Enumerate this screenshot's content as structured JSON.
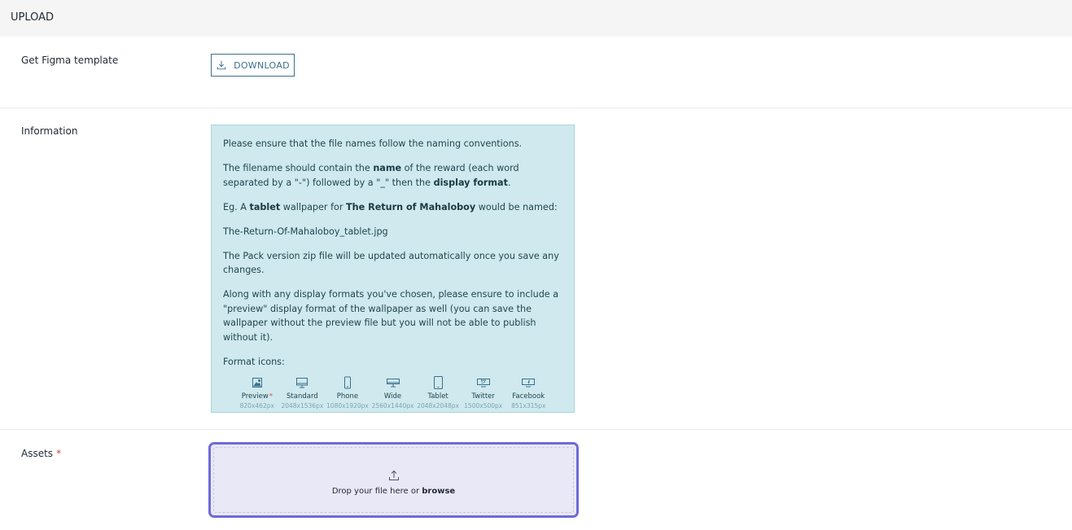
{
  "header": {
    "title": "UPLOAD"
  },
  "figma": {
    "label": "Get Figma template",
    "button_label": "DOWNLOAD"
  },
  "information": {
    "label": "Information",
    "p1": "Please ensure that the file names follow the naming conventions.",
    "p2_a": "The filename should contain the ",
    "p2_b": "name",
    "p2_c": " of the reward (each word separated by a \"-\") followed by a \"_\" then the ",
    "p2_d": "display format",
    "p2_e": ".",
    "p3_a": "Eg. A ",
    "p3_b": "tablet",
    "p3_c": " wallpaper for ",
    "p3_d": "The Return of Mahaloboy",
    "p3_e": " would be named:",
    "p4": "The-Return-Of-Mahaloboy_tablet.jpg",
    "p5": "The Pack version zip file will be updated automatically once you save any changes.",
    "p6": "Along with any display formats you've chosen, please ensure to include a \"preview\" display format of the wallpaper as well (you can save the wallpaper without the preview file but you will not be able to publish without it).",
    "format_icons_label": "Format icons:",
    "formats": [
      {
        "name": "Preview",
        "size": "820x462px",
        "icon": "image-icon",
        "required_mark": "*"
      },
      {
        "name": "Standard",
        "size": "2048x1536px",
        "icon": "monitor-icon"
      },
      {
        "name": "Phone",
        "size": "1080x1920px",
        "icon": "phone-icon"
      },
      {
        "name": "Wide",
        "size": "2560x1440px",
        "icon": "wide-monitor-icon"
      },
      {
        "name": "Tablet",
        "size": "2048x2048px",
        "icon": "tablet-icon"
      },
      {
        "name": "Twitter",
        "size": "1500x500px",
        "icon": "twitter-banner-icon"
      },
      {
        "name": "Facebook",
        "size": "851x315px",
        "icon": "facebook-banner-icon"
      }
    ]
  },
  "assets": {
    "label": "Assets",
    "required_mark": "*",
    "drop_text": "Drop your file here or ",
    "browse_text": "browse"
  },
  "colors": {
    "accent": "#6f6ad8",
    "info_bg": "#cfe9ee",
    "button_border": "#3d6f8d",
    "required": "#d64545"
  }
}
